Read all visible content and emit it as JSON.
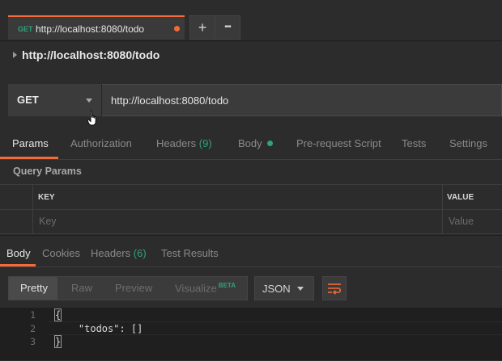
{
  "tab": {
    "method": "GET",
    "url": "http://localhost:8080/todo",
    "unsaved_color": "#f26b3a"
  },
  "tab_actions": {
    "new_tab": "+",
    "more": "•••"
  },
  "breadcrumb": {
    "title": "http://localhost:8080/todo"
  },
  "request": {
    "method": "GET",
    "url": "http://localhost:8080/todo"
  },
  "request_tabs": [
    {
      "label": "Params"
    },
    {
      "label": "Authorization"
    },
    {
      "label": "Headers",
      "count": "(9)"
    },
    {
      "label": "Body"
    },
    {
      "label": "Pre-request Script"
    },
    {
      "label": "Tests"
    },
    {
      "label": "Settings"
    }
  ],
  "query_params": {
    "title": "Query Params",
    "columns": [
      "KEY",
      "VALUE"
    ],
    "placeholders": {
      "key": "Key",
      "value": "Value"
    }
  },
  "response_tabs": [
    {
      "label": "Body"
    },
    {
      "label": "Cookies"
    },
    {
      "label": "Headers",
      "count": "(6)"
    },
    {
      "label": "Test Results"
    }
  ],
  "format": {
    "options": [
      "Pretty",
      "Raw",
      "Preview",
      "Visualize"
    ],
    "badge": "BETA",
    "selected": "Pretty",
    "language": "JSON"
  },
  "code_lines": [
    {
      "num": "1",
      "text": "{"
    },
    {
      "num": "2",
      "text": "    \"todos\": []"
    },
    {
      "num": "3",
      "text": "}"
    }
  ],
  "colors": {
    "accent": "#f26b3a",
    "teal": "#2fa37a",
    "background": "#2c2c2c"
  }
}
